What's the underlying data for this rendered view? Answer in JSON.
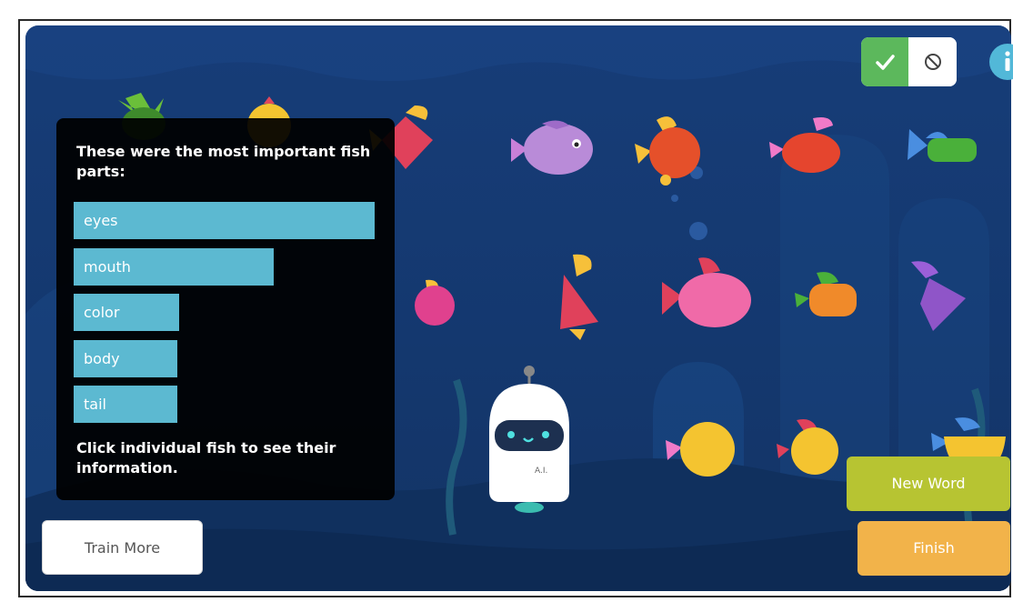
{
  "panel": {
    "title": "These were the most important fish parts:",
    "parts": [
      {
        "label": "eyes",
        "importance": 1.0
      },
      {
        "label": "mouth",
        "importance": 0.66
      },
      {
        "label": "color",
        "importance": 0.35
      },
      {
        "label": "body",
        "importance": 0.34
      },
      {
        "label": "tail",
        "importance": 0.34
      }
    ],
    "footer": "Click individual fish to see their information."
  },
  "buttons": {
    "train_more": "Train More",
    "new_word": "New Word",
    "finish": "Finish"
  },
  "robot": {
    "label": "A.I."
  },
  "colors": {
    "bar": "#5cb9d1",
    "new_word": "#b7c432",
    "finish": "#f2b34a",
    "toggle_yes": "#5cb85c",
    "info": "#52b8d8"
  },
  "icons": {
    "toggle_yes": "check-icon",
    "toggle_no": "no-symbol-icon",
    "info": "info-icon"
  }
}
